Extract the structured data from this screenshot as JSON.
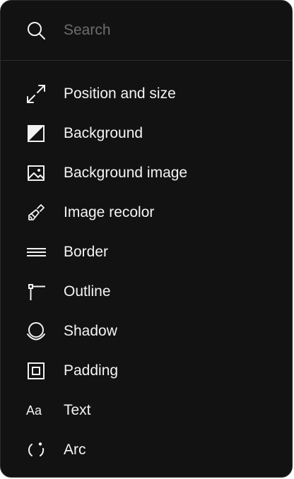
{
  "search": {
    "placeholder": "Search",
    "value": "",
    "icon": "search-icon"
  },
  "menu": {
    "items": [
      {
        "key": "position-and-size",
        "label": "Position and size",
        "icon": "expand-arrows-icon"
      },
      {
        "key": "background",
        "label": "Background",
        "icon": "half-filled-square-icon"
      },
      {
        "key": "background-image",
        "label": "Background image",
        "icon": "image-icon"
      },
      {
        "key": "image-recolor",
        "label": "Image recolor",
        "icon": "paint-brush-icon"
      },
      {
        "key": "border",
        "label": "Border",
        "icon": "border-lines-icon"
      },
      {
        "key": "outline",
        "label": "Outline",
        "icon": "outline-corner-icon"
      },
      {
        "key": "shadow",
        "label": "Shadow",
        "icon": "shadow-circle-icon"
      },
      {
        "key": "padding",
        "label": "Padding",
        "icon": "padding-square-icon"
      },
      {
        "key": "text",
        "label": "Text",
        "icon": "text-aa-icon",
        "glyph": "Aa"
      },
      {
        "key": "arc",
        "label": "Arc",
        "icon": "arc-icon"
      }
    ]
  },
  "colors": {
    "panel_background": "#121212",
    "text": "#f4f4f4",
    "placeholder": "#6e6e6e",
    "divider": "#2c2c2c"
  }
}
